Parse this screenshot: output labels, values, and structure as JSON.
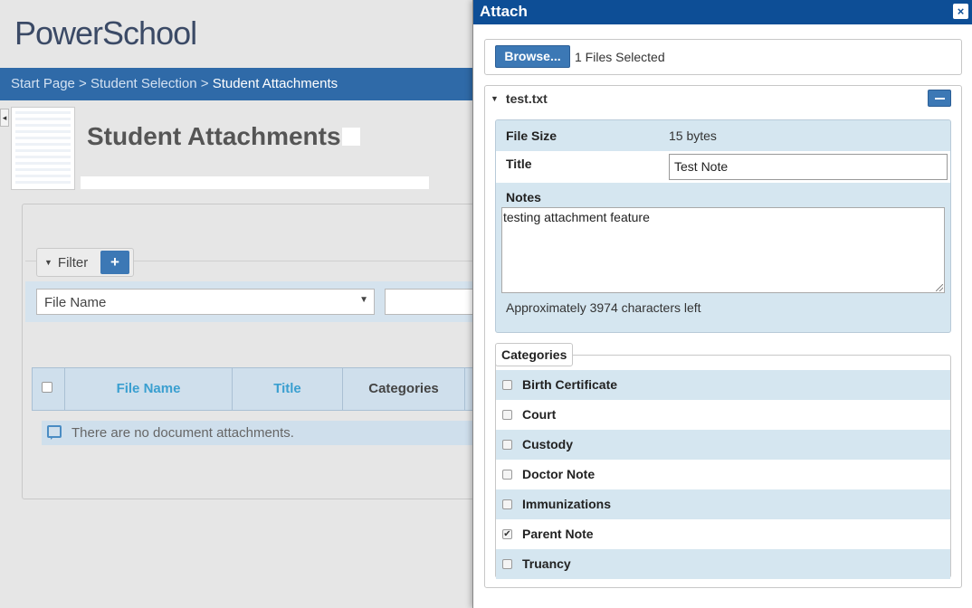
{
  "background": {
    "logo": "PowerSchool",
    "breadcrumb": {
      "start_page": "Start Page",
      "sep1": " > ",
      "student_selection": "Student Selection",
      "sep2": " > ",
      "current": "Student Attachments"
    },
    "page_title": "Student Attachments",
    "filter": {
      "legend": "Filter",
      "add_label": "+",
      "field_select_value": "File Name"
    },
    "table": {
      "columns": [
        "File Name",
        "Title",
        "Categories"
      ],
      "empty_message": "There are no document attachments."
    }
  },
  "dialog": {
    "title": "Attach",
    "close_label": "×",
    "browse_label": "Browse...",
    "files_selected": "1 Files Selected",
    "file": {
      "name": "test.txt",
      "size_label": "File Size",
      "size_value": "15 bytes",
      "title_label": "Title",
      "title_value": "Test Note",
      "notes_label": "Notes",
      "notes_value": "testing attachment feature",
      "chars_left": "Approximately 3974 characters left"
    },
    "categories": {
      "legend": "Categories",
      "items": [
        {
          "label": "Birth Certificate",
          "checked": false
        },
        {
          "label": "Court",
          "checked": false
        },
        {
          "label": "Custody",
          "checked": false
        },
        {
          "label": "Doctor Note",
          "checked": false
        },
        {
          "label": "Immunizations",
          "checked": false
        },
        {
          "label": "Parent Note",
          "checked": true
        },
        {
          "label": "Truancy",
          "checked": false
        }
      ]
    }
  },
  "colors": {
    "header_blue": "#0d4e96",
    "button_blue": "#3c78b5",
    "breadcrumb_blue": "#2f6aa8",
    "row_shade": "#d5e6f0",
    "link_color": "#3a9fd0"
  }
}
